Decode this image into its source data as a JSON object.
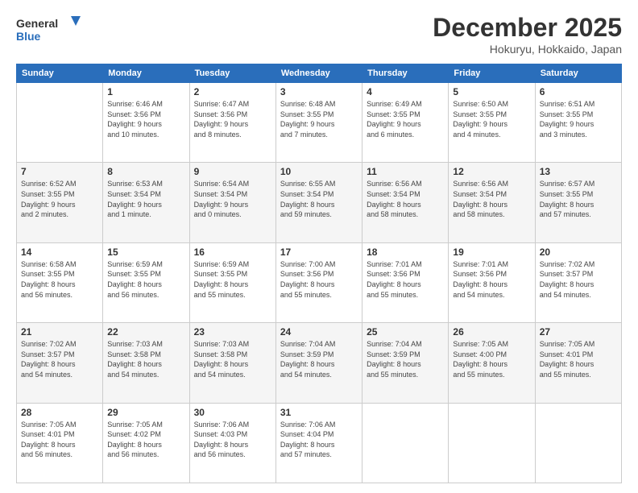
{
  "header": {
    "logo_line1": "General",
    "logo_line2": "Blue",
    "month": "December 2025",
    "location": "Hokuryu, Hokkaido, Japan"
  },
  "days_of_week": [
    "Sunday",
    "Monday",
    "Tuesday",
    "Wednesday",
    "Thursday",
    "Friday",
    "Saturday"
  ],
  "weeks": [
    [
      {
        "day": "",
        "info": ""
      },
      {
        "day": "1",
        "info": "Sunrise: 6:46 AM\nSunset: 3:56 PM\nDaylight: 9 hours\nand 10 minutes."
      },
      {
        "day": "2",
        "info": "Sunrise: 6:47 AM\nSunset: 3:56 PM\nDaylight: 9 hours\nand 8 minutes."
      },
      {
        "day": "3",
        "info": "Sunrise: 6:48 AM\nSunset: 3:55 PM\nDaylight: 9 hours\nand 7 minutes."
      },
      {
        "day": "4",
        "info": "Sunrise: 6:49 AM\nSunset: 3:55 PM\nDaylight: 9 hours\nand 6 minutes."
      },
      {
        "day": "5",
        "info": "Sunrise: 6:50 AM\nSunset: 3:55 PM\nDaylight: 9 hours\nand 4 minutes."
      },
      {
        "day": "6",
        "info": "Sunrise: 6:51 AM\nSunset: 3:55 PM\nDaylight: 9 hours\nand 3 minutes."
      }
    ],
    [
      {
        "day": "7",
        "info": "Sunrise: 6:52 AM\nSunset: 3:55 PM\nDaylight: 9 hours\nand 2 minutes."
      },
      {
        "day": "8",
        "info": "Sunrise: 6:53 AM\nSunset: 3:54 PM\nDaylight: 9 hours\nand 1 minute."
      },
      {
        "day": "9",
        "info": "Sunrise: 6:54 AM\nSunset: 3:54 PM\nDaylight: 9 hours\nand 0 minutes."
      },
      {
        "day": "10",
        "info": "Sunrise: 6:55 AM\nSunset: 3:54 PM\nDaylight: 8 hours\nand 59 minutes."
      },
      {
        "day": "11",
        "info": "Sunrise: 6:56 AM\nSunset: 3:54 PM\nDaylight: 8 hours\nand 58 minutes."
      },
      {
        "day": "12",
        "info": "Sunrise: 6:56 AM\nSunset: 3:54 PM\nDaylight: 8 hours\nand 58 minutes."
      },
      {
        "day": "13",
        "info": "Sunrise: 6:57 AM\nSunset: 3:55 PM\nDaylight: 8 hours\nand 57 minutes."
      }
    ],
    [
      {
        "day": "14",
        "info": "Sunrise: 6:58 AM\nSunset: 3:55 PM\nDaylight: 8 hours\nand 56 minutes."
      },
      {
        "day": "15",
        "info": "Sunrise: 6:59 AM\nSunset: 3:55 PM\nDaylight: 8 hours\nand 56 minutes."
      },
      {
        "day": "16",
        "info": "Sunrise: 6:59 AM\nSunset: 3:55 PM\nDaylight: 8 hours\nand 55 minutes."
      },
      {
        "day": "17",
        "info": "Sunrise: 7:00 AM\nSunset: 3:56 PM\nDaylight: 8 hours\nand 55 minutes."
      },
      {
        "day": "18",
        "info": "Sunrise: 7:01 AM\nSunset: 3:56 PM\nDaylight: 8 hours\nand 55 minutes."
      },
      {
        "day": "19",
        "info": "Sunrise: 7:01 AM\nSunset: 3:56 PM\nDaylight: 8 hours\nand 54 minutes."
      },
      {
        "day": "20",
        "info": "Sunrise: 7:02 AM\nSunset: 3:57 PM\nDaylight: 8 hours\nand 54 minutes."
      }
    ],
    [
      {
        "day": "21",
        "info": "Sunrise: 7:02 AM\nSunset: 3:57 PM\nDaylight: 8 hours\nand 54 minutes."
      },
      {
        "day": "22",
        "info": "Sunrise: 7:03 AM\nSunset: 3:58 PM\nDaylight: 8 hours\nand 54 minutes."
      },
      {
        "day": "23",
        "info": "Sunrise: 7:03 AM\nSunset: 3:58 PM\nDaylight: 8 hours\nand 54 minutes."
      },
      {
        "day": "24",
        "info": "Sunrise: 7:04 AM\nSunset: 3:59 PM\nDaylight: 8 hours\nand 54 minutes."
      },
      {
        "day": "25",
        "info": "Sunrise: 7:04 AM\nSunset: 3:59 PM\nDaylight: 8 hours\nand 55 minutes."
      },
      {
        "day": "26",
        "info": "Sunrise: 7:05 AM\nSunset: 4:00 PM\nDaylight: 8 hours\nand 55 minutes."
      },
      {
        "day": "27",
        "info": "Sunrise: 7:05 AM\nSunset: 4:01 PM\nDaylight: 8 hours\nand 55 minutes."
      }
    ],
    [
      {
        "day": "28",
        "info": "Sunrise: 7:05 AM\nSunset: 4:01 PM\nDaylight: 8 hours\nand 56 minutes."
      },
      {
        "day": "29",
        "info": "Sunrise: 7:05 AM\nSunset: 4:02 PM\nDaylight: 8 hours\nand 56 minutes."
      },
      {
        "day": "30",
        "info": "Sunrise: 7:06 AM\nSunset: 4:03 PM\nDaylight: 8 hours\nand 56 minutes."
      },
      {
        "day": "31",
        "info": "Sunrise: 7:06 AM\nSunset: 4:04 PM\nDaylight: 8 hours\nand 57 minutes."
      },
      {
        "day": "",
        "info": ""
      },
      {
        "day": "",
        "info": ""
      },
      {
        "day": "",
        "info": ""
      }
    ]
  ]
}
